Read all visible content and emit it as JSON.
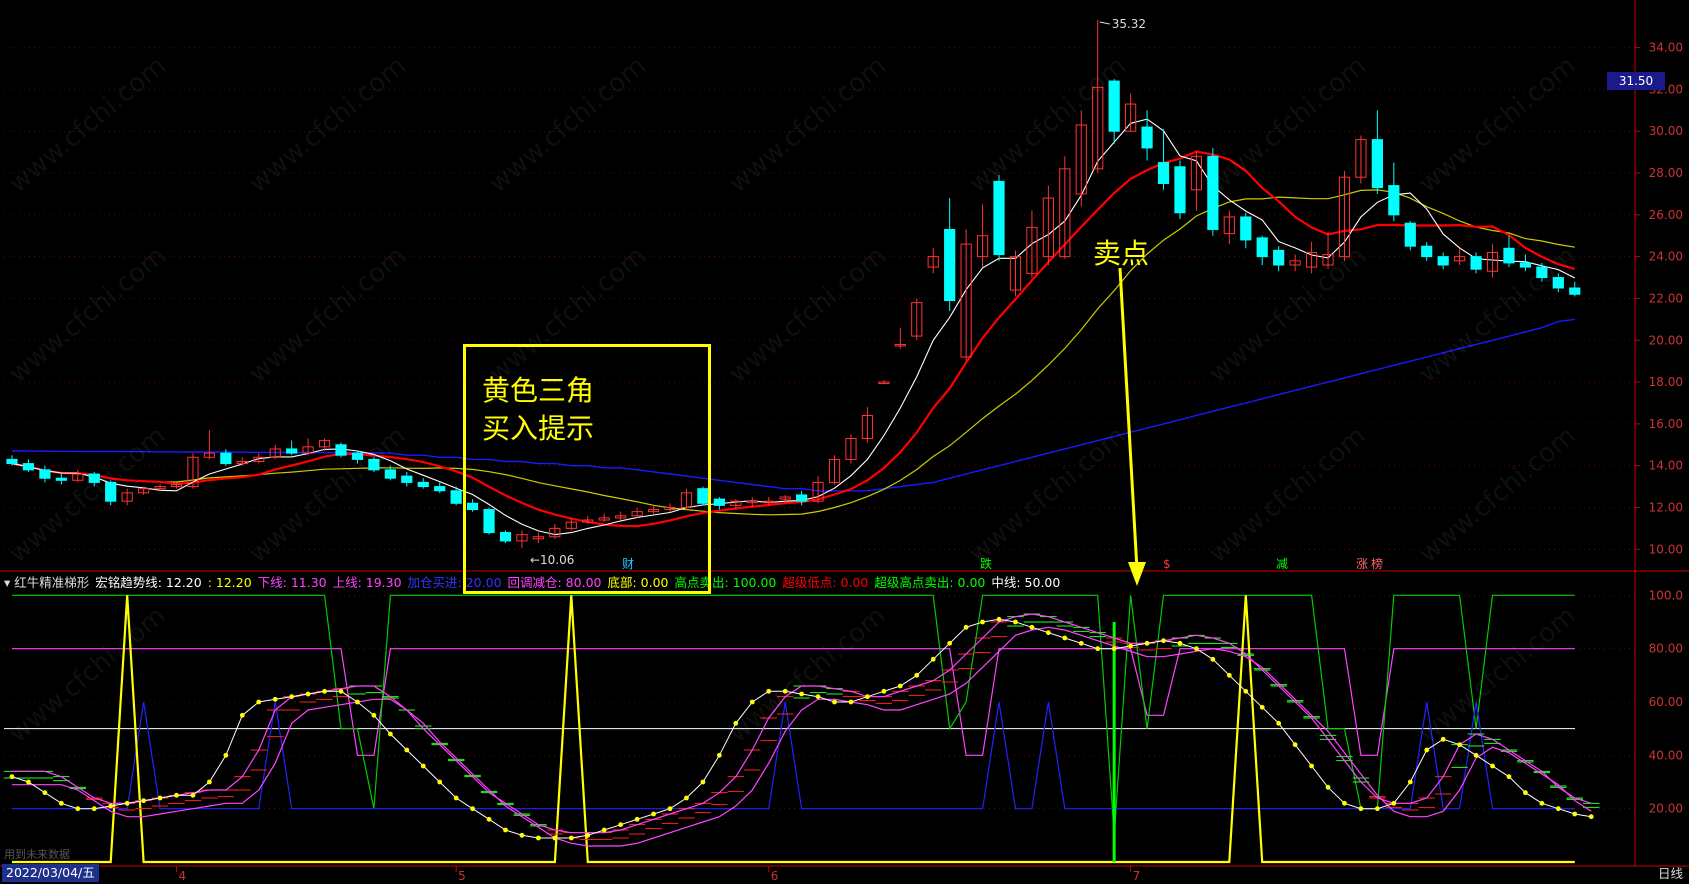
{
  "legend": [
    {
      "key": "indicator_name",
      "text": "红牛精准梯形",
      "color": "#dddddd"
    },
    {
      "key": "trend",
      "text": "宏铭趋势线: 12.20",
      "color": "#ffffff"
    },
    {
      "key": "trend2",
      "text": ": 12.20",
      "color": "#ffff00"
    },
    {
      "key": "lower",
      "text": "下线: 11.30",
      "color": "#ff44ff"
    },
    {
      "key": "upper",
      "text": "上线: 19.30",
      "color": "#ff44ff"
    },
    {
      "key": "add_buy",
      "text": "加仓买进: 20.00",
      "color": "#3333ff"
    },
    {
      "key": "pullback",
      "text": "回调减仓: 80.00",
      "color": "#ff44ff"
    },
    {
      "key": "bottom",
      "text": "底部: 0.00",
      "color": "#ffff00"
    },
    {
      "key": "high_sell",
      "text": "高点卖出: 100.00",
      "color": "#00ff00"
    },
    {
      "key": "super_low",
      "text": "超级低点: 0.00",
      "color": "#ff0000"
    },
    {
      "key": "super_high_sell",
      "text": "超级高点卖出: 0.00",
      "color": "#00ff00"
    },
    {
      "key": "midline",
      "text": "中线: 50.00",
      "color": "#ffffff"
    }
  ],
  "annotations": {
    "buy_hint_line1": "黄色三角",
    "buy_hint_line2": "买入提示",
    "sell_point": "卖点",
    "high_label": "35.32",
    "low_label": "10.06"
  },
  "badges": [
    {
      "text": "财",
      "color": "#22ccff"
    },
    {
      "text": "跌",
      "color": "#00ff00"
    },
    {
      "text": "$",
      "color": "#ff3333"
    },
    {
      "text": "减",
      "color": "#00ff00"
    },
    {
      "text": "涨",
      "color": "#ff6666"
    },
    {
      "text": "榜",
      "color": "#ff6666"
    }
  ],
  "current_price_tag": "31.50",
  "footer": {
    "date": "2022/03/04/五",
    "period": "日线",
    "hint": "用到未来数据"
  },
  "colors": {
    "up": "#ff3333",
    "down": "#00ffff",
    "ma5": "#ffffff",
    "ma10": "#ff0000",
    "ma20": "#cccc00",
    "ma60": "#1a1aff",
    "grid": "#aa0000",
    "axis": "#cc0000"
  },
  "chart_data": {
    "type": "candlestick",
    "price_axis": {
      "ylim": [
        9.2,
        35.8
      ],
      "ticks": [
        10,
        12,
        14,
        16,
        18,
        20,
        22,
        24,
        26,
        28,
        30,
        32,
        34
      ],
      "tick_labels": [
        "10.00",
        "12.00",
        "14.00",
        "16.00",
        "18.00",
        "20.00",
        "22.00",
        "24.00",
        "26.00",
        "28.00",
        "30.00",
        "32.00",
        "34.00"
      ]
    },
    "indicator_axis": {
      "ylim": [
        0,
        105
      ],
      "ticks": [
        20,
        40,
        60,
        80,
        100
      ],
      "tick_labels": [
        "20.00",
        "40.00",
        "60.00",
        "80.00",
        "100.0"
      ]
    },
    "x_labels": [
      "4",
      "5",
      "6",
      "7"
    ],
    "x_label_index": [
      10,
      27,
      46,
      68
    ],
    "candles": [
      [
        14.3,
        14.1,
        14.5,
        14.0
      ],
      [
        14.1,
        13.8,
        14.3,
        13.7
      ],
      [
        13.8,
        13.4,
        14.0,
        13.2
      ],
      [
        13.4,
        13.3,
        13.6,
        13.1
      ],
      [
        13.3,
        13.6,
        13.8,
        13.2
      ],
      [
        13.6,
        13.2,
        13.7,
        13.0
      ],
      [
        13.2,
        12.3,
        13.3,
        12.1
      ],
      [
        12.3,
        12.7,
        12.9,
        12.1
      ],
      [
        12.7,
        12.9,
        13.0,
        12.6
      ],
      [
        12.9,
        13.0,
        13.1,
        12.8
      ],
      [
        13.0,
        13.1,
        13.2,
        12.9
      ],
      [
        13.0,
        14.4,
        14.6,
        12.9
      ],
      [
        14.4,
        14.6,
        15.7,
        14.3
      ],
      [
        14.6,
        14.1,
        14.8,
        14.0
      ],
      [
        14.1,
        14.2,
        14.4,
        14.0
      ],
      [
        14.2,
        14.4,
        14.6,
        14.1
      ],
      [
        14.4,
        14.8,
        15.0,
        14.3
      ],
      [
        14.8,
        14.6,
        15.2,
        14.5
      ],
      [
        14.6,
        14.9,
        15.3,
        14.5
      ],
      [
        14.9,
        15.2,
        15.3,
        14.7
      ],
      [
        15.0,
        14.5,
        15.1,
        14.4
      ],
      [
        14.6,
        14.3,
        14.7,
        14.1
      ],
      [
        14.3,
        13.8,
        14.4,
        13.7
      ],
      [
        13.8,
        13.4,
        14.0,
        13.3
      ],
      [
        13.5,
        13.2,
        13.7,
        13.0
      ],
      [
        13.2,
        13.0,
        13.4,
        12.9
      ],
      [
        13.0,
        12.8,
        13.2,
        12.7
      ],
      [
        12.8,
        12.2,
        13.0,
        12.1
      ],
      [
        12.2,
        11.9,
        12.4,
        11.8
      ],
      [
        11.9,
        10.8,
        12.0,
        10.7
      ],
      [
        10.8,
        10.4,
        10.9,
        10.3
      ],
      [
        10.4,
        10.7,
        10.9,
        10.06
      ],
      [
        10.5,
        10.6,
        10.8,
        10.3
      ],
      [
        10.6,
        11.0,
        11.2,
        10.5
      ],
      [
        11.0,
        11.3,
        11.5,
        10.9
      ],
      [
        11.3,
        11.4,
        11.6,
        11.2
      ],
      [
        11.4,
        11.5,
        11.7,
        11.3
      ],
      [
        11.5,
        11.6,
        11.8,
        11.4
      ],
      [
        11.6,
        11.8,
        12.0,
        11.5
      ],
      [
        11.8,
        11.9,
        12.1,
        11.7
      ],
      [
        11.9,
        12.0,
        12.2,
        11.8
      ],
      [
        12.0,
        12.7,
        12.9,
        11.9
      ],
      [
        12.9,
        12.2,
        13.0,
        12.1
      ],
      [
        12.4,
        12.1,
        12.5,
        11.9
      ],
      [
        12.1,
        12.3,
        12.4,
        11.9
      ],
      [
        12.3,
        12.3,
        12.5,
        12.0
      ],
      [
        12.3,
        12.3,
        12.5,
        12.1
      ],
      [
        12.4,
        12.5,
        12.6,
        12.2
      ],
      [
        12.6,
        12.3,
        12.8,
        12.1
      ],
      [
        12.3,
        13.2,
        13.5,
        12.2
      ],
      [
        13.2,
        14.3,
        14.5,
        13.1
      ],
      [
        14.3,
        15.3,
        15.5,
        14.1
      ],
      [
        15.3,
        16.4,
        16.8,
        15.1
      ],
      [
        18.0,
        18.0,
        18.1,
        17.9
      ],
      [
        19.8,
        19.8,
        20.6,
        19.6
      ],
      [
        20.2,
        21.8,
        22.0,
        20.0
      ],
      [
        23.5,
        24.0,
        24.4,
        23.2
      ],
      [
        25.3,
        21.9,
        26.8,
        21.4
      ],
      [
        19.2,
        24.6,
        25.3,
        19.0
      ],
      [
        24.0,
        25.0,
        26.5,
        23.5
      ],
      [
        27.6,
        24.1,
        27.9,
        23.8
      ],
      [
        22.4,
        24.0,
        24.3,
        22.1
      ],
      [
        23.2,
        25.4,
        26.2,
        23.0
      ],
      [
        24.0,
        26.8,
        27.4,
        23.6
      ],
      [
        24.0,
        28.2,
        28.8,
        23.9
      ],
      [
        27.0,
        30.3,
        31.0,
        26.4
      ],
      [
        28.2,
        32.1,
        35.32,
        28.0
      ],
      [
        32.4,
        30.0,
        32.5,
        29.4
      ],
      [
        30.0,
        31.3,
        31.8,
        30.0
      ],
      [
        30.2,
        29.2,
        31.0,
        28.6
      ],
      [
        28.5,
        27.5,
        30.1,
        27.2
      ],
      [
        28.3,
        26.1,
        28.6,
        25.8
      ],
      [
        27.2,
        28.8,
        29.0,
        26.2
      ],
      [
        28.8,
        25.3,
        29.2,
        25.0
      ],
      [
        25.1,
        25.9,
        26.2,
        24.6
      ],
      [
        25.9,
        24.8,
        26.1,
        24.4
      ],
      [
        24.9,
        24.0,
        25.0,
        23.6
      ],
      [
        24.3,
        23.6,
        24.5,
        23.3
      ],
      [
        23.6,
        23.8,
        24.1,
        23.3
      ],
      [
        23.5,
        24.2,
        24.7,
        23.2
      ],
      [
        23.6,
        24.1,
        25.2,
        23.4
      ],
      [
        24.0,
        27.8,
        28.1,
        23.8
      ],
      [
        27.8,
        29.6,
        29.8,
        27.5
      ],
      [
        29.6,
        27.3,
        31.0,
        27.0
      ],
      [
        27.4,
        26.0,
        28.5,
        25.7
      ],
      [
        25.6,
        24.5,
        25.7,
        24.3
      ],
      [
        24.5,
        24.0,
        24.7,
        23.8
      ],
      [
        24.0,
        23.6,
        24.2,
        23.4
      ],
      [
        23.8,
        24.0,
        24.4,
        23.6
      ],
      [
        24.0,
        23.4,
        24.2,
        23.2
      ],
      [
        23.3,
        24.2,
        24.6,
        23.0
      ],
      [
        24.4,
        23.7,
        25.0,
        23.5
      ],
      [
        23.7,
        23.5,
        24.1,
        23.3
      ],
      [
        23.5,
        23.0,
        23.7,
        22.8
      ],
      [
        23.0,
        22.5,
        23.2,
        22.3
      ],
      [
        22.5,
        22.2,
        22.8,
        22.1
      ]
    ],
    "ma60": [
      14.6,
      14.5,
      14.5,
      14.4,
      14.4,
      14.3,
      14.3,
      14.2,
      14.2,
      14.1,
      14.1,
      14.0,
      14.0,
      13.9,
      13.9,
      13.8,
      13.7,
      13.6,
      13.5,
      13.4,
      13.3,
      13.2,
      13.1,
      13.0,
      12.9,
      12.9,
      12.8,
      12.8,
      12.8,
      12.8,
      12.9,
      13.0,
      13.1,
      13.2,
      13.4,
      13.6,
      13.8,
      14.0,
      14.2,
      14.4,
      14.6,
      14.8,
      15.0,
      15.2,
      15.4,
      15.6,
      15.8,
      16.0,
      16.2,
      16.4,
      16.6,
      16.8,
      17.0,
      17.2,
      17.4,
      17.6,
      17.8,
      18.0,
      18.2,
      18.4,
      18.6,
      18.8,
      19.0,
      19.2,
      19.4,
      19.6,
      19.8,
      20.0,
      20.2,
      20.4,
      20.6,
      20.9,
      21.0
    ],
    "ma60_start": 24,
    "indicator": {
      "midline": 50,
      "purple_step": [
        80,
        80,
        80,
        80,
        80,
        80,
        80,
        80,
        80,
        80,
        80,
        80,
        80,
        80,
        80,
        80,
        80,
        80,
        80,
        80,
        80,
        80,
        80,
        80,
        80,
        80,
        80,
        80,
        80,
        80,
        80,
        80,
        80,
        80,
        80,
        80,
        80,
        80,
        80,
        80,
        80,
        80,
        80,
        80,
        80,
        80,
        80,
        80,
        80,
        80,
        80,
        80,
        80,
        80,
        80,
        80,
        80,
        80,
        80,
        80,
        80,
        80,
        80,
        80,
        80,
        80,
        80,
        80,
        80,
        80,
        80,
        80,
        80,
        80,
        80,
        80,
        80,
        80,
        80,
        80,
        80,
        80,
        80,
        80,
        80,
        80,
        80,
        80,
        80,
        80,
        80,
        80,
        80,
        80,
        80,
        80
      ],
      "dots": [
        32,
        30,
        26,
        22,
        20,
        20,
        21,
        22,
        23,
        24,
        25,
        25,
        30,
        40,
        55,
        60,
        61,
        62,
        63,
        64,
        64,
        60,
        55,
        48,
        42,
        36,
        30,
        24,
        20,
        16,
        12,
        10,
        9,
        9,
        9,
        10,
        12,
        14,
        16,
        18,
        20,
        24,
        30,
        40,
        52,
        60,
        64,
        64,
        63,
        62,
        60,
        60,
        62,
        64,
        66,
        70,
        76,
        82,
        88,
        90,
        91,
        90,
        88,
        86,
        84,
        82,
        80,
        80,
        81,
        82,
        83,
        82,
        80,
        76,
        70,
        64,
        58,
        52,
        44,
        36,
        28,
        22,
        20,
        20,
        22,
        30,
        42,
        46,
        44,
        40,
        36,
        32,
        26,
        22,
        20,
        18,
        17
      ]
    }
  }
}
